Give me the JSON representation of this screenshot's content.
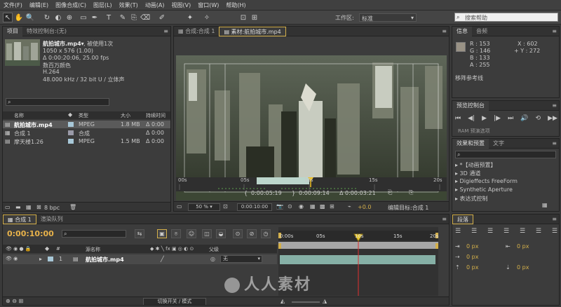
{
  "menu": [
    "文件(F)",
    "编辑(E)",
    "图像合成(C)",
    "图层(L)",
    "效果(T)",
    "动画(A)",
    "视图(V)",
    "窗口(W)",
    "帮助(H)"
  ],
  "toolbar": {
    "workspace_label": "工作区:",
    "workspace_value": "标准",
    "search_placeholder": "搜索帮助"
  },
  "project": {
    "tab": "项目",
    "tab2": "特效控制台:(无)",
    "file_name": "航拍城市.mp4▾",
    "usage": ", 被使用1次",
    "info": [
      "1050 x 576 (1.00)",
      "Δ 0:00:20:06, 25.00 fps",
      "数百万颜色",
      "H.264",
      "48.000 kHz / 32 bit U / 立体声"
    ],
    "cols": {
      "name": "名称",
      "type": "类型",
      "size": "大小",
      "duration": "持续时间"
    },
    "items": [
      {
        "name": "航拍城市.mp4",
        "type": "MPEG",
        "size": "1.8 MB",
        "duration": "Δ 0:00",
        "color": "#a8c8d8"
      },
      {
        "name": "合成 1",
        "type": "合成",
        "size": "",
        "duration": "Δ 0:00",
        "color": "#9a9aa8"
      },
      {
        "name": "摩天楼1.26",
        "type": "MPEG",
        "size": "1.5 MB",
        "duration": "Δ 0:00",
        "color": "#a8c8d8"
      }
    ],
    "bpc": "8 bpc"
  },
  "viewer": {
    "tab1": "合成:合成 1",
    "tab2": "素材:航拍城市.mp4",
    "ruler": [
      "00s",
      "05s",
      "10s",
      "15s",
      "20s"
    ],
    "time_in": "0:00:05:19",
    "time_out": "0:00:09:14",
    "duration": "Δ 0:00:03:21",
    "zoom": "50 %",
    "timecode": "0:00:10:00",
    "offset": "+0.0",
    "target": "编辑目标:合成 1"
  },
  "info_panel": {
    "tab": "信息",
    "tab2": "音频",
    "r": "R : 153",
    "g": "G : 146",
    "b": "B : 133",
    "a": "A : 255",
    "x": "X : 602",
    "y": "+ Y : 272",
    "note": "移阵参考线",
    "swatch_color": "#999285"
  },
  "preview": {
    "tab": "预览控制台",
    "preset": "RAM 预演选项"
  },
  "effects": {
    "tab": "效果和预置",
    "tab2": "文字",
    "items": [
      "▸ *【动画预置】",
      "▸ 3D 通道",
      "▸ Digieffects FreeForm",
      "▸ Synthetic Aperture",
      "▸ 表达式控制"
    ]
  },
  "timeline": {
    "tab": "合成 1",
    "tab2": "渲染队列",
    "time": "0:00:10:00",
    "ruler": [
      "0:00s",
      "05s",
      "10s",
      "15s",
      "20s"
    ],
    "cols": {
      "name": "源名称",
      "parent": "父级"
    },
    "layer": {
      "num": "1",
      "name": "航拍城市.mp4",
      "parent": "无"
    },
    "footer": "切换开关 / 模式"
  },
  "paragraph": {
    "tab": "段落",
    "values": [
      "0 px",
      "0 px",
      "0 px",
      "0 px",
      "0 px"
    ]
  },
  "watermark": "人人素材"
}
